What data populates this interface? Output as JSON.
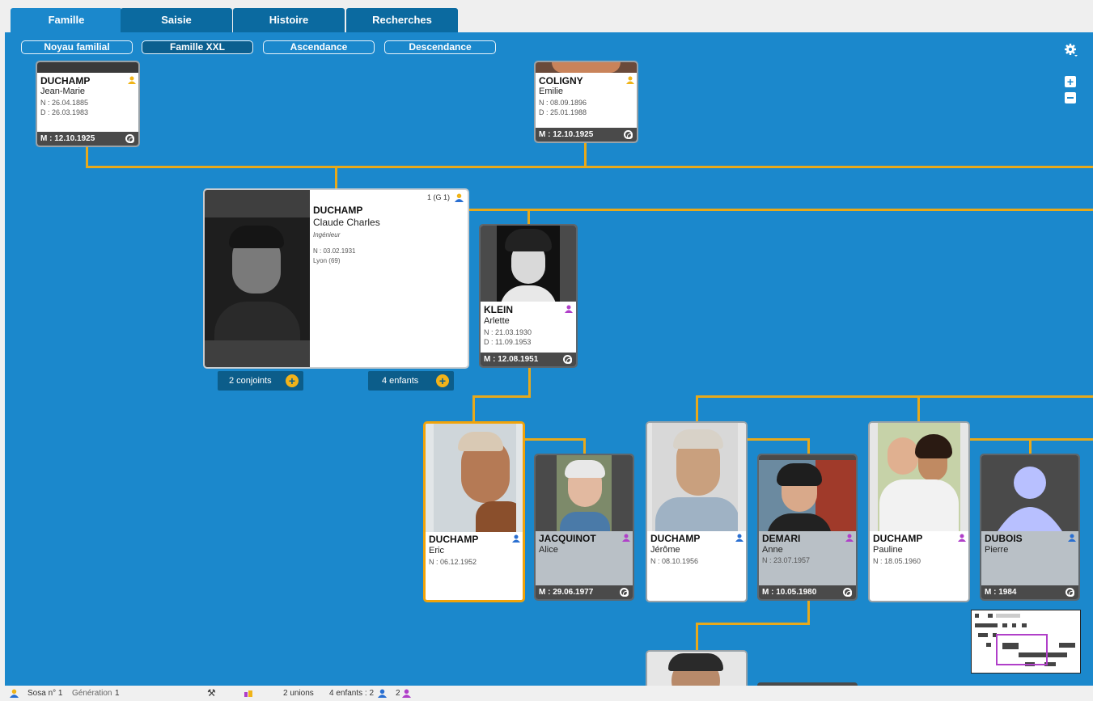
{
  "tabs": [
    {
      "label": "Famille"
    },
    {
      "label": "Saisie"
    },
    {
      "label": "Histoire"
    },
    {
      "label": "Recherches"
    }
  ],
  "subtabs": [
    {
      "label": "Noyau familial"
    },
    {
      "label": "Famille XXL"
    },
    {
      "label": "Ascendance"
    },
    {
      "label": "Descendance"
    }
  ],
  "people": {
    "p1": {
      "name": "DUCHAMP",
      "first": "Jean-Marie",
      "birth": "N : 26.04.1885",
      "death": "D : 26.03.1983",
      "marriage": "M : 12.10.1925"
    },
    "p2": {
      "name": "COLIGNY",
      "first": "Emilie",
      "birth": "N : 08.09.1896",
      "death": "D : 25.01.1988",
      "marriage": "M : 12.10.1925"
    },
    "main": {
      "badge": "1 (G 1)",
      "name": "DUCHAMP",
      "first": "Claude Charles",
      "job": "Ingénieur",
      "birth": "N : 03.02.1931",
      "place": "Lyon (69)"
    },
    "klein": {
      "name": "KLEIN",
      "first": "Arlette",
      "birth": "N : 21.03.1930",
      "death": "D : 11.09.1953",
      "marriage": "M : 12.08.1951"
    },
    "eric": {
      "name": "DUCHAMP",
      "first": "Eric",
      "birth": "N : 06.12.1952"
    },
    "alice": {
      "name": "JACQUINOT",
      "first": "Alice",
      "marriage": "M : 29.06.1977"
    },
    "jerome": {
      "name": "DUCHAMP",
      "first": "Jérôme",
      "birth": "N : 08.10.1956"
    },
    "anne": {
      "name": "DEMARI",
      "first": "Anne",
      "birth": "N : 23.07.1957",
      "marriage": "M : 10.05.1980"
    },
    "pauline": {
      "name": "DUCHAMP",
      "first": "Pauline",
      "birth": "N : 18.05.1960"
    },
    "pierre": {
      "name": "DUBOIS",
      "first": "Pierre",
      "marriage": "M : 1984"
    }
  },
  "pills": {
    "conjoints": "2 conjoints",
    "enfants": "4 enfants"
  },
  "status": {
    "sosa": "Sosa n° 1",
    "generation_label": "Génération",
    "generation": "1",
    "unions": "2 unions",
    "children": "4 enfants : 2",
    "children_f": "2"
  },
  "colors": {
    "canvas": "#1b88cc",
    "line": "#e8a91a",
    "male": "#2a6fd1",
    "female": "#b03fc9",
    "root": "#f0b418"
  }
}
